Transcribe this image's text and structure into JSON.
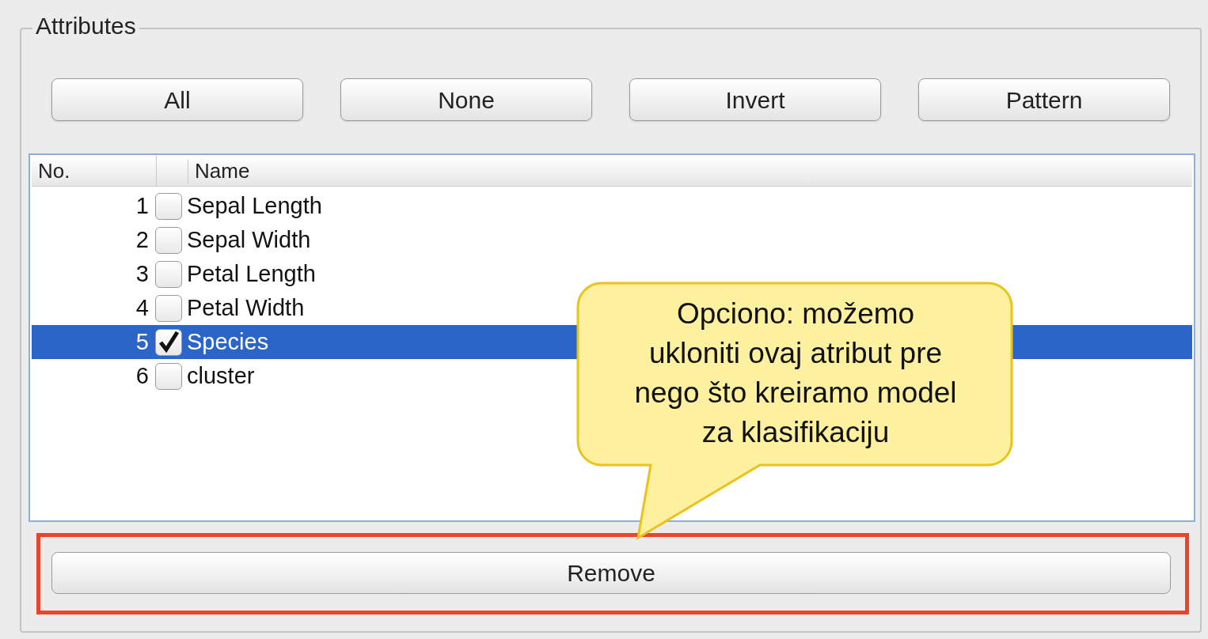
{
  "panel": {
    "title": "Attributes"
  },
  "buttons": [
    "All",
    "None",
    "Invert",
    "Pattern"
  ],
  "table": {
    "columns": [
      "No.",
      "Name"
    ],
    "rows": [
      {
        "no": "1",
        "name": "Sepal Length",
        "checked": false,
        "selected": false
      },
      {
        "no": "2",
        "name": "Sepal Width",
        "checked": false,
        "selected": false
      },
      {
        "no": "3",
        "name": "Petal Length",
        "checked": false,
        "selected": false
      },
      {
        "no": "4",
        "name": "Petal Width",
        "checked": false,
        "selected": false
      },
      {
        "no": "5",
        "name": "Species",
        "checked": true,
        "selected": true
      },
      {
        "no": "6",
        "name": "cluster",
        "checked": false,
        "selected": false
      }
    ]
  },
  "callout": {
    "lines": [
      "Opciono: možemo",
      "ukloniti ovaj atribut pre",
      "nego što kreiramo model",
      "za klasifikaciju"
    ]
  },
  "remove_button": {
    "label": "Remove",
    "highlighted": true
  }
}
